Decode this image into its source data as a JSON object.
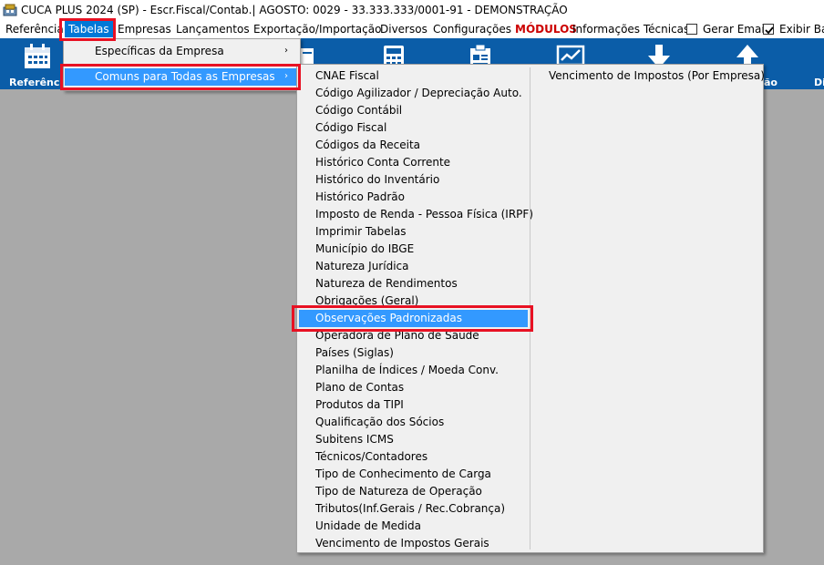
{
  "window": {
    "title": "CUCA PLUS 2024 (SP) - Escr.Fiscal/Contab.| AGOSTO: 0029 - 33.333.333/0001-91 - DEMONSTRAÇÃO"
  },
  "menubar": {
    "items": [
      "Referência",
      "Tabelas",
      "Empresas",
      "Lançamentos",
      "Exportação/Importação",
      "Diversos",
      "Configurações",
      "MÓDULOS",
      "Informações Técnicas"
    ],
    "gerar_email": "Gerar Email",
    "exibir_barra": "Exibir Bar",
    "gerar_email_checked": false,
    "exibir_barra_checked": true
  },
  "toolbar": {
    "referencia_label": "Referênci",
    "right_label_1": "ão",
    "right_label_2": "Di"
  },
  "tabelas_menu": {
    "items": [
      "Específicas da Empresa",
      "Comuns para Todas as Empresas"
    ],
    "arrow": "›"
  },
  "comuns_menu": {
    "col1": [
      "CNAE Fiscal",
      "Código Agilizador / Depreciação Auto.",
      "Código Contábil",
      "Código Fiscal",
      "Códigos da Receita",
      "Histórico Conta Corrente",
      "Histórico do Inventário",
      "Histórico Padrão",
      "Imposto de Renda - Pessoa Física (IRPF)",
      "Imprimir Tabelas",
      "Município do IBGE",
      "Natureza Jurídica",
      "Natureza de Rendimentos",
      "Obrigações (Geral)",
      "Observações Padronizadas",
      "Operadora de Plano de Saúde",
      "Países (Siglas)",
      "Planilha de Índices / Moeda Conv.",
      "Plano de Contas",
      "Produtos da TIPI",
      "Qualificação dos Sócios",
      "Subitens ICMS",
      "Técnicos/Contadores",
      "Tipo de Conhecimento de Carga",
      "Tipo de Natureza de Operação",
      "Tributos(Inf.Gerais / Rec.Cobrança)",
      "Unidade de Medida",
      "Vencimento de Impostos Gerais"
    ],
    "col2": [
      "Vencimento de Impostos (Por Empresa)"
    ]
  },
  "colors": {
    "toolbar_bg": "#0b5da8",
    "highlight": "#3399ff",
    "menu_active": "#0078d7",
    "annotation_red": "#e81123",
    "modulos_red": "#cc0000"
  }
}
